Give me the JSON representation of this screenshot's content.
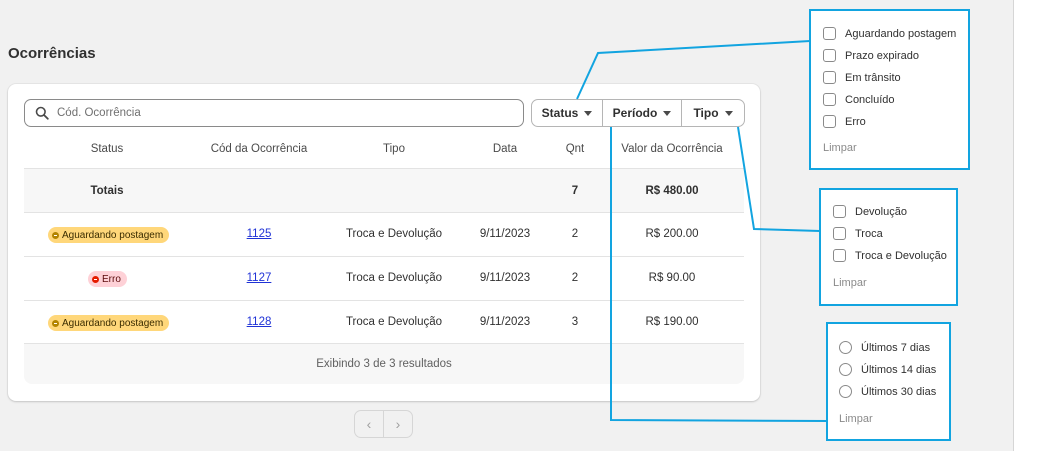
{
  "page": {
    "title": "Ocorrências"
  },
  "search": {
    "placeholder": "Cód. Ocorrência"
  },
  "filters": [
    {
      "label": "Status"
    },
    {
      "label": "Período"
    },
    {
      "label": "Tipo"
    }
  ],
  "table": {
    "headers": [
      "Status",
      "Cód da Ocorrência",
      "Tipo",
      "Data",
      "Qnt",
      "Valor da Ocorrência"
    ],
    "totals": {
      "label": "Totais",
      "qnt": "7",
      "valor": "R$ 480.00"
    },
    "rows": [
      {
        "status": "Aguardando postagem",
        "codigo": "1125",
        "tipo": "Troca e Devolução",
        "data": "9/11/2023",
        "qnt": "2",
        "valor": "R$ 200.00"
      },
      {
        "status": "Erro",
        "codigo": "1127",
        "tipo": "Troca e Devolução",
        "data": "9/11/2023",
        "qnt": "2",
        "valor": "R$ 90.00"
      },
      {
        "status": "Aguardando postagem",
        "codigo": "1128",
        "tipo": "Troca e Devolução",
        "data": "9/11/2023",
        "qnt": "3",
        "valor": "R$ 190.00"
      }
    ],
    "footer": "Exibindo 3 de 3 resultados"
  },
  "pagination": {
    "prev_icon": "chevron-left-icon",
    "next_icon": "chevron-right-icon"
  },
  "status_popup": {
    "options": [
      "Aguardando postagem",
      "Prazo expirado",
      "Em trânsito",
      "Concluído",
      "Erro"
    ],
    "clear": "Limpar"
  },
  "tipo_popup": {
    "options": [
      "Devolução",
      "Troca",
      "Troca e Devolução"
    ],
    "clear": "Limpar"
  },
  "periodo_popup": {
    "options": [
      "Últimos 7 dias",
      "Últimos 14 dias",
      "Últimos 30 dias"
    ],
    "clear": "Limpar"
  },
  "colors": {
    "badge_pending_bg": "#ffd77a",
    "badge_pending_dot": "#b28400",
    "badge_error_bg": "#fed1d7",
    "badge_error_dot": "#e51c00",
    "annotation_blue": "#12a4e0",
    "link": "#1f32d6"
  }
}
